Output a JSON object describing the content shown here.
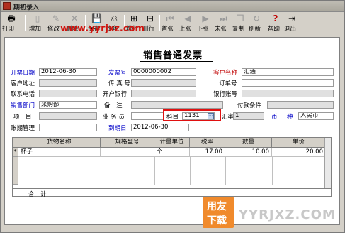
{
  "window": {
    "title": "期初录入"
  },
  "toolbar": {
    "print": "打印",
    "add": "增加",
    "edit": "修改",
    "delete": "删除",
    "save": "保存",
    "discard": "放弃",
    "insert_row": "增行",
    "delete_row": "删行",
    "first": "首张",
    "prev": "上张",
    "next": "下张",
    "last": "末张",
    "copy": "复制",
    "refresh": "刷新",
    "help": "帮助",
    "exit": "退出"
  },
  "watermark": "www.yyrjxz.com",
  "form": {
    "title": "销售普通发票",
    "invoice_date_label": "开票日期",
    "invoice_date": "2012-06-30",
    "invoice_no_label": "发票号",
    "invoice_no": "0000000002",
    "customer_name_label": "客户名称",
    "customer_name": "汇通",
    "customer_address_label": "客户地址",
    "fax_label": "传 真 号",
    "order_no_label": "订单号",
    "contact_phone_label": "联系电话",
    "bank_label": "开户银行",
    "bank_account_label": "银行账号",
    "sales_dept_label": "销售部门",
    "sales_dept": "采购部",
    "remark_label": "备　注",
    "payment_terms_label": "付款条件",
    "project_label": "项　目",
    "salesman_label": "业 务 员",
    "subject_label": "科目",
    "subject_value": "1131",
    "exchange_rate_label": "汇率",
    "exchange_rate": "1",
    "currency_label": "币　种",
    "currency": "人民币",
    "aging_label": "账期管理",
    "due_date_label": "到期日",
    "due_date": "2012-06-30"
  },
  "grid": {
    "headers": [
      "货物名称",
      "规格型号",
      "计量单位",
      "税率",
      "数量",
      "单价"
    ],
    "rows": [
      {
        "mark": "*",
        "name": "杯子",
        "spec": "",
        "unit": "个",
        "tax_rate": "17.00",
        "qty": "10.00",
        "price": "20.00"
      }
    ],
    "total_label": "合　计"
  },
  "branding": {
    "logo_top": "用友",
    "logo_bottom": "下载",
    "logo_text": "YYRJXZ.COM"
  }
}
